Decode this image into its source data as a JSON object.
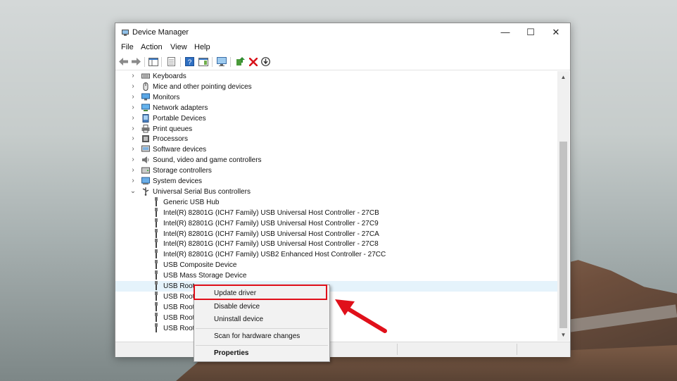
{
  "window": {
    "title": "Device Manager",
    "minimize": "—",
    "maximize": "☐",
    "close": "✕"
  },
  "menubar": {
    "items": [
      "File",
      "Action",
      "View",
      "Help"
    ]
  },
  "toolbar": {
    "icons": [
      "back-arrow-icon",
      "forward-arrow-icon",
      "show-hide-console-tree-icon",
      "properties-icon",
      "help-icon",
      "show-action-pane-icon",
      "monitor-icon",
      "update-driver-icon",
      "uninstall-x-icon",
      "download-icon"
    ]
  },
  "tree": {
    "categories": [
      {
        "label": "Keyboards",
        "icon": "keyboard-icon"
      },
      {
        "label": "Mice and other pointing devices",
        "icon": "mouse-icon"
      },
      {
        "label": "Monitors",
        "icon": "monitor-icon"
      },
      {
        "label": "Network adapters",
        "icon": "network-icon"
      },
      {
        "label": "Portable Devices",
        "icon": "portable-device-icon"
      },
      {
        "label": "Print queues",
        "icon": "printer-icon"
      },
      {
        "label": "Processors",
        "icon": "processor-icon"
      },
      {
        "label": "Software devices",
        "icon": "software-device-icon"
      },
      {
        "label": "Sound, video and game controllers",
        "icon": "speaker-icon"
      },
      {
        "label": "Storage controllers",
        "icon": "storage-icon"
      },
      {
        "label": "System devices",
        "icon": "system-device-icon"
      },
      {
        "label": "Universal Serial Bus controllers",
        "icon": "usb-icon",
        "expanded": true
      }
    ],
    "usb_children": [
      "Generic USB Hub",
      "Intel(R) 82801G (ICH7 Family) USB Universal Host Controller - 27CB",
      "Intel(R) 82801G (ICH7 Family) USB Universal Host Controller - 27C9",
      "Intel(R) 82801G (ICH7 Family) USB Universal Host Controller - 27CA",
      "Intel(R) 82801G (ICH7 Family) USB Universal Host Controller - 27C8",
      "Intel(R) 82801G (ICH7 Family) USB2 Enhanced Host Controller - 27CC",
      "USB Composite Device",
      "USB Mass Storage Device",
      "USB Root",
      "USB Root",
      "USB Root",
      "USB Root",
      "USB Root"
    ]
  },
  "context_menu": {
    "update_driver": "Update driver",
    "disable_device": "Disable device",
    "uninstall_device": "Uninstall device",
    "scan_hardware": "Scan for hardware changes",
    "properties": "Properties"
  },
  "colors": {
    "highlight": "#e0101a",
    "selection": "#e5f3fb"
  }
}
